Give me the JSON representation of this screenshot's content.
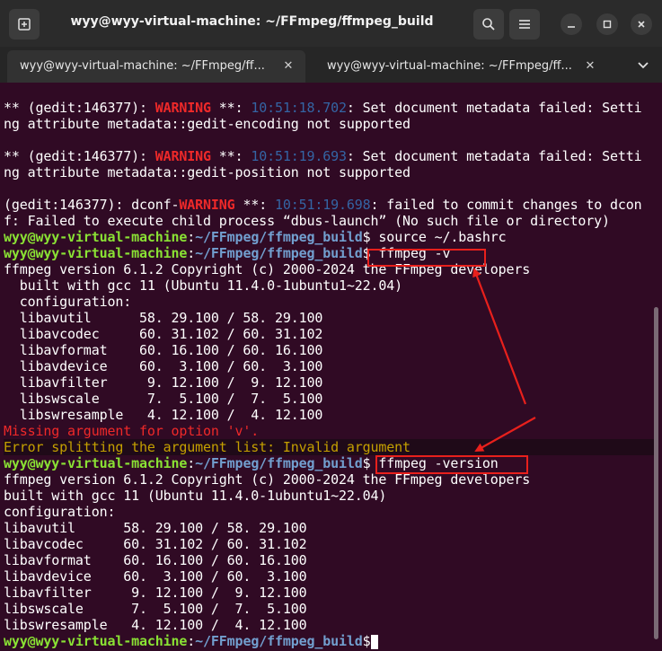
{
  "window": {
    "title": "wyy@wyy-virtual-machine: ~/FFmpeg/ffmpeg_build"
  },
  "icons": {
    "new_tab": "new-tab-icon",
    "search": "search-icon",
    "menu": "hamburger-menu-icon",
    "minimize": "minimize-icon",
    "maximize": "maximize-icon",
    "close": "close-icon",
    "tab_close": "close-icon",
    "tabs_dropdown": "chevron-down-icon"
  },
  "tabs": [
    {
      "label": "wyy@wyy-virtual-machine: ~/FFmpeg/ff...",
      "close": "✕",
      "active": true
    },
    {
      "label": "wyy@wyy-virtual-machine: ~/FFmpeg/ff...",
      "close": "✕",
      "active": false
    }
  ],
  "prompt": {
    "user": "wyy@wyy-virtual-machine",
    "colon": ":",
    "path": "~/FFmpeg/ffmpeg_build",
    "symbol": "$"
  },
  "terminal": {
    "gedit_warn_1_a": "** (gedit:146377): ",
    "gedit_warn_1_b": "WARNING",
    "gedit_warn_1_c": " **: ",
    "gedit_warn_1_time": "10:51:18.702",
    "gedit_warn_1_d": ": Set document metadata failed: Setti",
    "gedit_warn_1_e": "ng attribute metadata::gedit-encoding not supported",
    "gedit_warn_2_a": "** (gedit:146377): ",
    "gedit_warn_2_b": "WARNING",
    "gedit_warn_2_c": " **: ",
    "gedit_warn_2_time": "10:51:19.693",
    "gedit_warn_2_d": ": Set document metadata failed: Setti",
    "gedit_warn_2_e": "ng attribute metadata::gedit-position not supported",
    "dconf_a": "(gedit:146377): dconf-",
    "dconf_b": "WARNING",
    "dconf_c": " **: ",
    "dconf_time": "10:51:19.698",
    "dconf_d": ": failed to commit changes to dcon",
    "dconf_e": "f: Failed to execute child process “dbus-launch” (No such file or directory)",
    "cmd_source": " source ~/.bashrc",
    "cmd_v": " ffmpeg -v",
    "v_out": [
      "ffmpeg version 6.1.2 Copyright (c) 2000-2024 the FFmpeg developers",
      "  built with gcc 11 (Ubuntu 11.4.0-1ubuntu1~22.04)",
      "  configuration:",
      "  libavutil      58. 29.100 / 58. 29.100",
      "  libavcodec     60. 31.102 / 60. 31.102",
      "  libavformat    60. 16.100 / 60. 16.100",
      "  libavdevice    60.  3.100 / 60.  3.100",
      "  libavfilter     9. 12.100 /  9. 12.100",
      "  libswscale      7.  5.100 /  7.  5.100",
      "  libswresample   4. 12.100 /  4. 12.100"
    ],
    "err_missing": "Missing argument for option 'v'.",
    "err_split": "Error splitting the argument list: Invalid argument",
    "cmd_version": " ffmpeg -version",
    "version_out": [
      "ffmpeg version 6.1.2 Copyright (c) 2000-2024 the FFmpeg developers",
      "built with gcc 11 (Ubuntu 11.4.0-1ubuntu1~22.04)",
      "configuration:",
      "libavutil      58. 29.100 / 58. 29.100",
      "libavcodec     60. 31.102 / 60. 31.102",
      "libavformat    60. 16.100 / 60. 16.100",
      "libavdevice    60.  3.100 / 60.  3.100",
      "libavfilter     9. 12.100 /  9. 12.100",
      "libswscale      7.  5.100 /  7.  5.100",
      "libswresample   4. 12.100 /  4. 12.100"
    ]
  },
  "colors": {
    "terminal_bg": "#300a24",
    "prompt_user": "#8ae234",
    "prompt_path": "#729fcf",
    "warning": "#ef2929",
    "timestamp": "#3465a4",
    "annotation": "#e8201c"
  }
}
